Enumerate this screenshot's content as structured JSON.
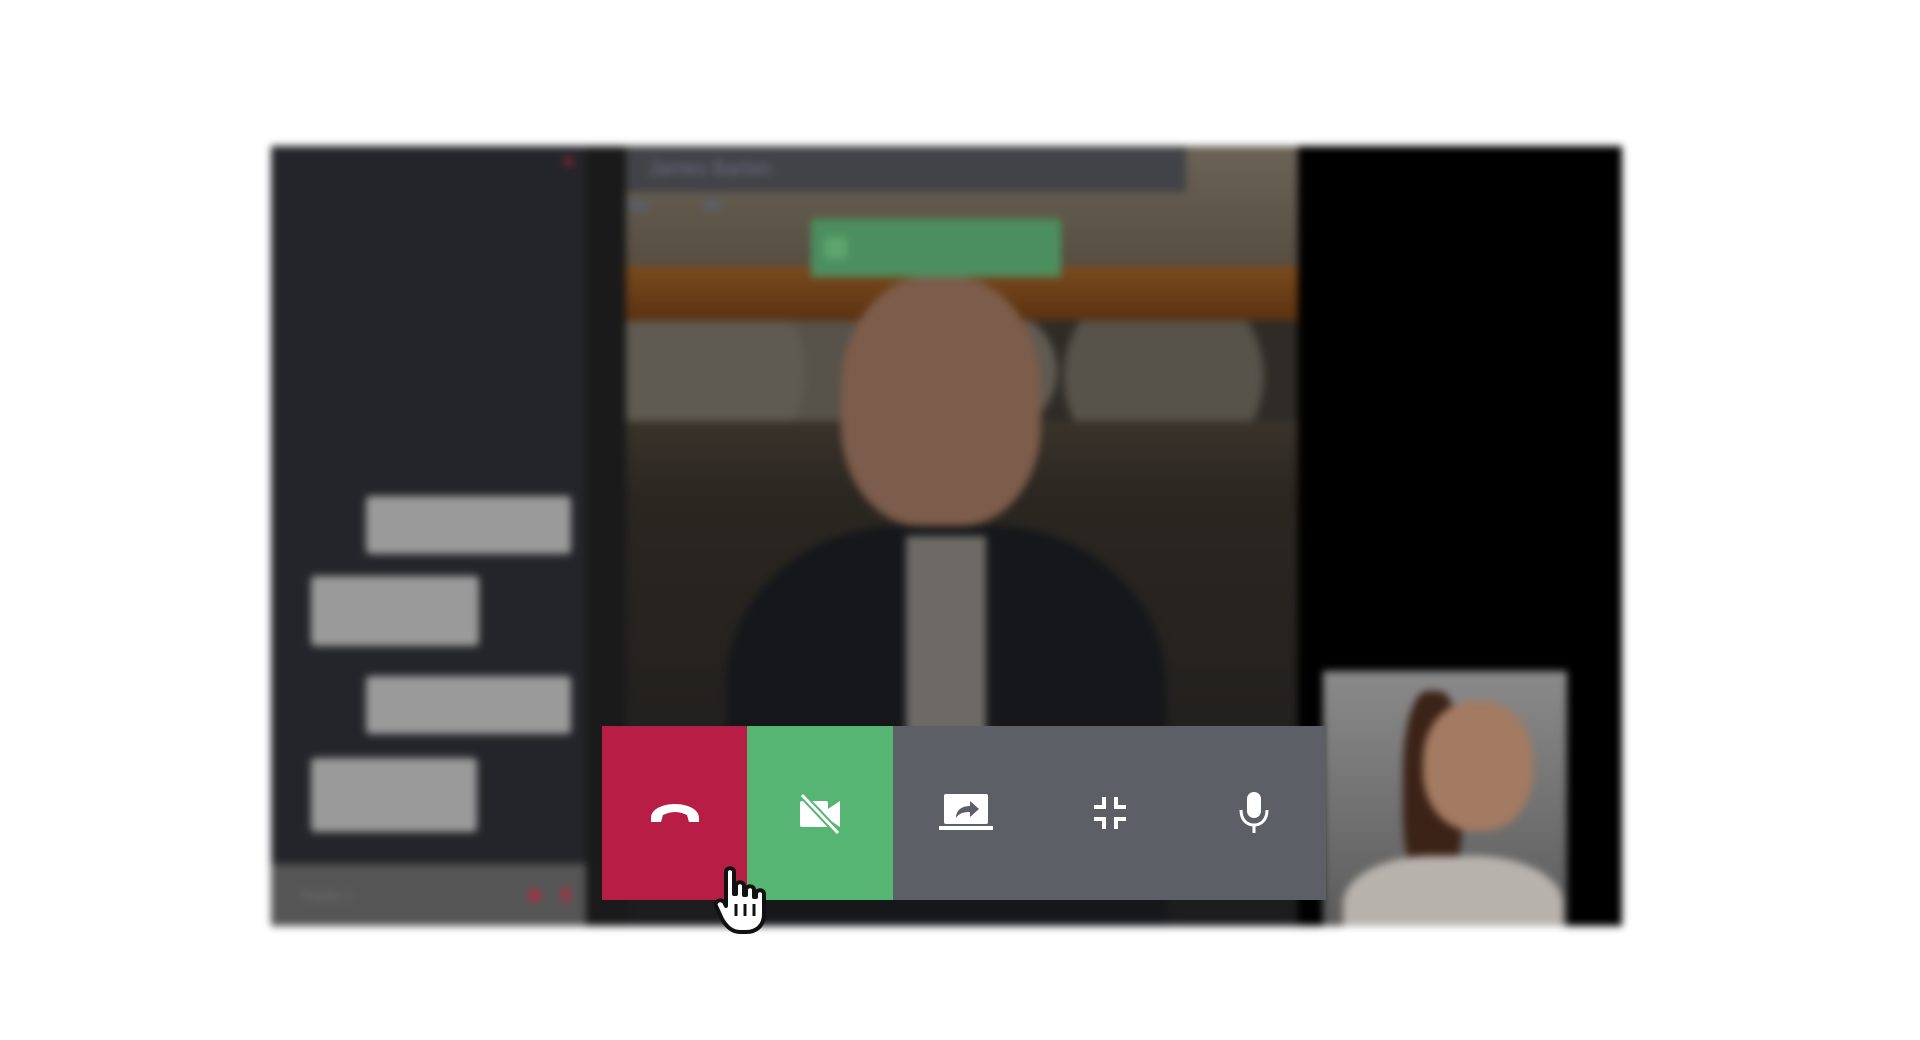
{
  "caller": {
    "name": "James Barton"
  },
  "chart_fragment": {
    "ticks": [
      "Jun",
      "Jul"
    ]
  },
  "chat": {
    "close_icon": "close-icon",
    "messages": [
      {
        "sender": "",
        "text": "",
        "side": "mine"
      },
      {
        "sender": "",
        "text": "",
        "side": "theirs"
      },
      {
        "sender": "",
        "text": "",
        "side": "mine"
      },
      {
        "sender": "",
        "text": "",
        "side": "theirs"
      }
    ],
    "input_placeholder": "Thanks :)",
    "send_icon": "send-icon",
    "attach_icon": "attach-icon"
  },
  "controls": {
    "end_call_icon": "phone-hangup-icon",
    "video_toggle_icon": "video-off-icon",
    "share_screen_icon": "screen-share-icon",
    "exit_fullscreen_icon": "fullscreen-exit-icon",
    "mic_icon": "microphone-icon"
  },
  "colors": {
    "end_call": "#b81d45",
    "video_toggle": "#56b572",
    "controls_bg": "#5d5f66",
    "chat_panel_bg": "#24252a"
  },
  "cursor": {
    "icon": "hand-pointer-icon"
  }
}
